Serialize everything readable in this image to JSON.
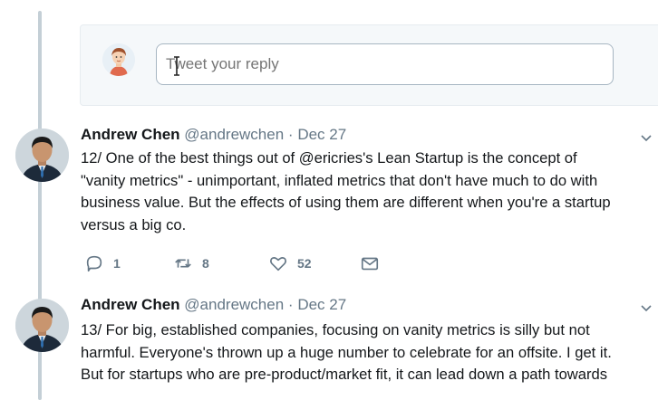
{
  "reply": {
    "placeholder": "Tweet your reply"
  },
  "tweets": [
    {
      "name": "Andrew Chen",
      "handle": "@andrewchen",
      "separator": "·",
      "date": "Dec 27",
      "lines": [
        "12/ One of the best things out of @ericries's Lean Startup is the concept of",
        "\"vanity metrics\" - unimportant, inflated metrics that don't have much to do with",
        "business value. But the effects of using them are different when you're a startup",
        "versus a big co."
      ],
      "replies": "1",
      "retweets": "8",
      "likes": "52"
    },
    {
      "name": "Andrew Chen",
      "handle": "@andrewchen",
      "separator": "·",
      "date": "Dec 27",
      "lines": [
        "13/ For big, established companies, focusing on vanity metrics is silly but not",
        "harmful. Everyone's thrown up a huge number to celebrate for an offsite. I get it.",
        "But for startups who are pre-product/market fit, it can lead down a path towards"
      ]
    }
  ],
  "icons": {
    "reply": "reply-icon",
    "retweet": "retweet-icon",
    "like": "heart-icon",
    "dm": "envelope-icon",
    "caret": "chevron-down-icon"
  },
  "colors": {
    "text": "#14171a",
    "muted": "#657786",
    "thread": "#c4cfd6"
  }
}
